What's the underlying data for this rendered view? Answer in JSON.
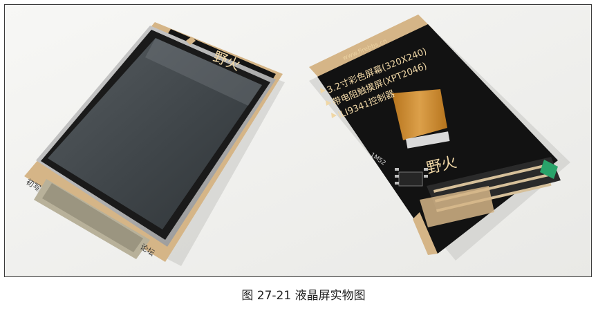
{
  "figure": {
    "caption": "图 27-21 液晶屏实物图"
  },
  "module_front": {
    "brand": "野火",
    "corner_left": "初写",
    "corner_right": "论坛"
  },
  "module_back": {
    "url": "www.firebbs.cn",
    "spec_lines": [
      "3.2寸彩色屏幕(320X240)",
      "带电阻触摸屏(XPT2046)",
      "ILI9341控制器"
    ],
    "chip_label": "1M52",
    "brand": "野火"
  },
  "colors": {
    "pcb_black": "#111111",
    "pcb_gold": "#d7b88a",
    "flex_cable": "#c98a2e",
    "screen": "#3d4448"
  }
}
